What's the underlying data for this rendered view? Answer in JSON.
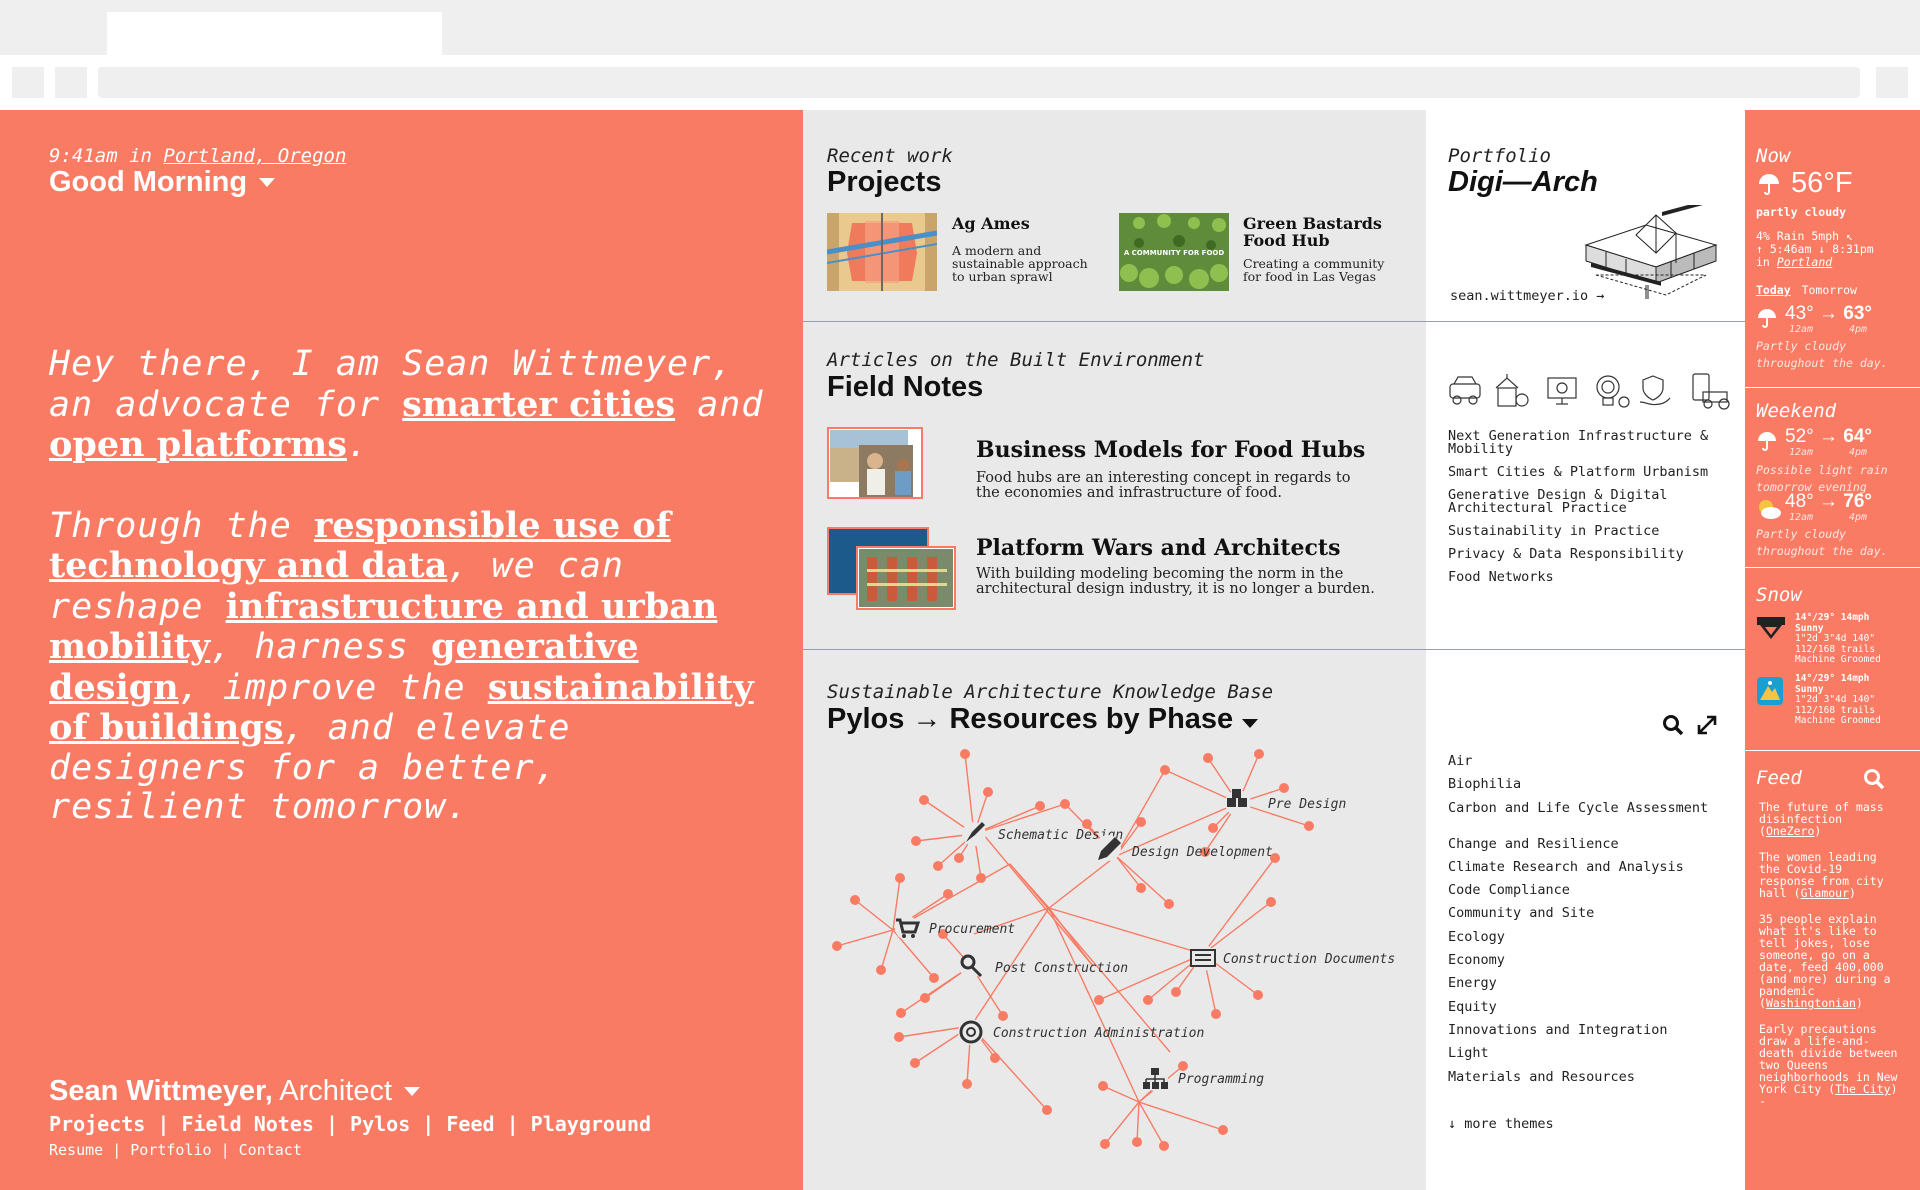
{
  "colors": {
    "accent": "#f97b64",
    "panel_gray": "#e9e9e9",
    "white": "#ffffff"
  },
  "intro": {
    "time": "9:41am",
    "time_in": " in ",
    "location": "Portland, Oregon",
    "greeting": "Good Morning",
    "p1_a": "Hey there, I am Sean Wittmeyer, an advocate for ",
    "link_smarter_cities": "smarter cities",
    "p1_b": " and ",
    "link_open_platforms": "open platforms",
    "p1_c": ".",
    "p2_a": "Through the ",
    "link_responsible": "responsible use of technology and data",
    "p2_b": ", we can reshape ",
    "link_infrastructure": "infrastructure and urban mobility",
    "p2_c": ", harness ",
    "link_generative": "generative design",
    "p2_d": ", improve the ",
    "link_sustainability": "sustainability of buildings",
    "p2_e": ", and elevate designers for a better, resilient tomorrow."
  },
  "footer": {
    "name": "Sean Wittmeyer,",
    "role": " Architect",
    "nav": [
      "Projects",
      "Field Notes",
      "Pylos",
      "Feed",
      "Playground"
    ],
    "subnav": [
      "Resume",
      "Portfolio",
      "Contact"
    ],
    "sep": " | "
  },
  "projects": {
    "kicker": "Recent work",
    "title": "Projects",
    "items": [
      {
        "title": "Ag Ames",
        "desc": "A modern and sustainable approach to urban sprawl"
      },
      {
        "title": "Green Bastards Food Hub",
        "desc": "Creating a community for food in Las Vegas",
        "thumb_text": "A COMMUNITY FOR FOOD"
      }
    ]
  },
  "portfolio": {
    "kicker": "Portfolio",
    "title": "Digi—Arch",
    "link": "sean.wittmeyer.io →"
  },
  "fieldnotes": {
    "kicker": "Articles on the Built Environment",
    "title": "Field Notes",
    "articles": [
      {
        "title": "Business Models for Food Hubs",
        "desc": "Food hubs are an interesting concept in regards to the economies and infrastructure of food."
      },
      {
        "title": "Platform Wars and Architects",
        "desc": "With building modeling becoming the norm in the architectural design industry, it is no longer a burden."
      }
    ],
    "icons": [
      "car-icon",
      "farm-icon",
      "computer-icon",
      "idea-icon",
      "shield-hand-icon",
      "phone-tractor-icon"
    ],
    "themes": [
      "Next Generation Infrastructure & Mobility",
      "Smart Cities & Platform Urbanism",
      "Generative Design & Digital Architectural Practice",
      "Sustainability in Practice",
      "Privacy & Data Responsibility",
      "Food Networks"
    ]
  },
  "pylos": {
    "kicker": "Sustainable Architecture Knowledge Base",
    "title": "Pylos → Resources by Phase",
    "phases": [
      "Schematic Design",
      "Pre Design",
      "Design Development",
      "Procurement",
      "Post Construction",
      "Construction Documents",
      "Construction Administration",
      "Programming"
    ],
    "themes": [
      "Air",
      "Biophilia",
      "Carbon and Life Cycle Assessment",
      "Change and Resilience",
      "Climate Research and Analysis",
      "Code Compliance",
      "Community and Site",
      "Ecology",
      "Economy",
      "Energy",
      "Equity",
      "Innovations and Integration",
      "Light",
      "Materials and Resources"
    ],
    "more": "↓ more themes"
  },
  "weather": {
    "heading": "Now",
    "temp": "56°F",
    "condition": "partly cloudy",
    "details1": "4% Rain  5mph ↖",
    "details2": "↑ 5:46am ↓ 8:31pm",
    "in": "in ",
    "location": "Portland",
    "tab_today": "Today",
    "tab_tomorrow": "Tomorrow",
    "today": {
      "low": "43°",
      "high": "63°",
      "low_time": "12am",
      "high_time": "4pm",
      "summary": "Partly cloudy throughout the day."
    },
    "arrow": "→",
    "weekend_heading": "Weekend",
    "weekend": [
      {
        "low": "52°",
        "high": "64°",
        "low_time": "12am",
        "high_time": "4pm",
        "summary": "Possible light rain tomorrow evening"
      },
      {
        "low": "48°",
        "high": "76°",
        "low_time": "12am",
        "high_time": "4pm",
        "summary": "Partly cloudy throughout the day."
      }
    ]
  },
  "snow": {
    "heading": "Snow",
    "resorts": [
      {
        "line1": "14°/29° 14mph",
        "line2": "Sunny",
        "line3": "1\"2d 3\"4d 140\"",
        "line4": "112/168 trails",
        "line5": "Machine Groomed"
      },
      {
        "line1": "14°/29° 14mph",
        "line2": "Sunny",
        "line3": "1\"2d 3\"4d 140\"",
        "line4": "112/168 trails",
        "line5": "Machine Groomed"
      }
    ]
  },
  "feed": {
    "heading": "Feed",
    "items": [
      {
        "text": "The future of mass disinfection",
        "source": "OneZero"
      },
      {
        "text": "The women leading the Covid-19 response from city hall",
        "source": "Glamour"
      },
      {
        "text": "35 people explain what it's like to tell jokes, lose someone, go on a date, feed 400,000 (and more) during a pandemic",
        "source": "Washingtonian"
      },
      {
        "text": "Early precautions draw a life-and-death divide between two Queens neighborhoods in New York City",
        "source": "The City",
        "tail": " -"
      }
    ]
  }
}
